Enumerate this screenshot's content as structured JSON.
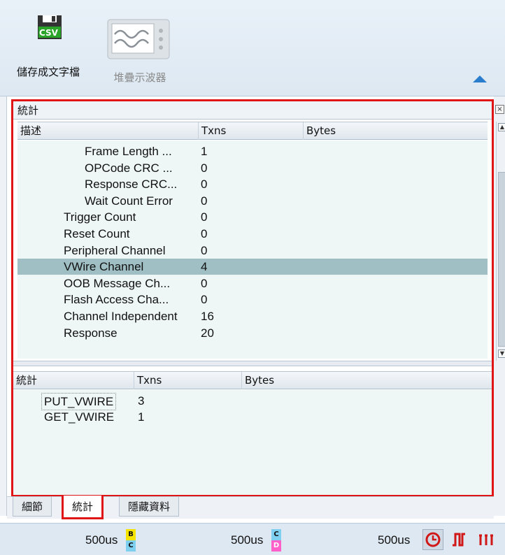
{
  "ribbon": {
    "save_csv": {
      "badge": "CSV",
      "label": "儲存成文字檔"
    },
    "stacked_scope": {
      "label": "堆疊示波器"
    }
  },
  "panel": {
    "close_label": "×",
    "title": "統計",
    "top_grid": {
      "columns": [
        "描述",
        "Txns",
        "Bytes"
      ],
      "rows": [
        {
          "desc": "Frame Length ...",
          "txns": "1",
          "level": 2
        },
        {
          "desc": "OPCode CRC ...",
          "txns": "0",
          "level": 2
        },
        {
          "desc": "Response CRC...",
          "txns": "0",
          "level": 2
        },
        {
          "desc": "Wait Count Error",
          "txns": "0",
          "level": 2
        },
        {
          "desc": "Trigger Count",
          "txns": "0",
          "level": 1
        },
        {
          "desc": "Reset Count",
          "txns": "0",
          "level": 1
        },
        {
          "desc": "Peripheral Channel",
          "txns": "0",
          "level": 1
        },
        {
          "desc": "VWire Channel",
          "txns": "4",
          "level": 1,
          "selected": true
        },
        {
          "desc": "OOB Message Ch...",
          "txns": "0",
          "level": 1
        },
        {
          "desc": "Flash Access Cha...",
          "txns": "0",
          "level": 1
        },
        {
          "desc": "Channel Independent",
          "txns": "16",
          "level": 1
        },
        {
          "desc": "Response",
          "txns": "20",
          "level": 1
        }
      ]
    },
    "bottom_grid": {
      "columns": [
        "統計",
        "Txns",
        "Bytes"
      ],
      "rows": [
        {
          "desc": "PUT_VWIRE",
          "txns": "3",
          "focused": true
        },
        {
          "desc": "GET_VWIRE",
          "txns": "1"
        }
      ]
    }
  },
  "tabs": [
    {
      "label": "細節"
    },
    {
      "label": "統計",
      "active": true
    },
    {
      "label": "隱藏資料"
    }
  ],
  "statusbar": {
    "markers": [
      {
        "time": "500us",
        "top": "B",
        "bottom": "C",
        "top_color": "#f5e400",
        "bottom_color": "#7fd0f0"
      },
      {
        "time": "500us",
        "top": "C",
        "bottom": "D",
        "top_color": "#7fd0f0",
        "bottom_color": "#ff5fc8"
      },
      {
        "time": "500us"
      }
    ],
    "tools": [
      "clock-icon",
      "pulse-icon",
      "multi-pulse-icon"
    ]
  },
  "colors": {
    "highlight": "#e01515",
    "accent": "#2a7ccc",
    "selected_row": "#9fbfc4"
  }
}
